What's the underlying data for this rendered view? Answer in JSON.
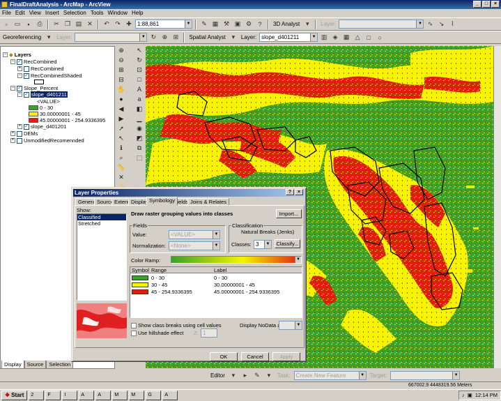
{
  "window": {
    "title": "FinalDraftAnalysis - ArcMap - ArcView"
  },
  "menu": [
    "File",
    "Edit",
    "View",
    "Insert",
    "Selection",
    "Tools",
    "Window",
    "Help"
  ],
  "toolbar1": {
    "scale": "1:88,861",
    "analyst_label": "3D Analyst",
    "layer_label": "Layer:"
  },
  "toolbar2": {
    "georef_label": "Georeferencing",
    "layer_label": "Layer:",
    "spatial_label": "Spatial Analyst",
    "layer2_label": "Layer:",
    "active_layer": "slope_d401211"
  },
  "toc": {
    "root": "Layers",
    "items": {
      "rec_combined": "RecCombined",
      "rec_combined_sub": "RecCombined",
      "rec_combined_shaded": "RecCombinedShaded",
      "slope_percent": "Slope_Percent",
      "slope_sel": "slope_d401211",
      "value_field": "<VALUE>",
      "class1": "0 - 30",
      "class2": "30.00000001 - 45",
      "class3": "45.00000001 - 254.9336395",
      "slope2": "slope_d401201",
      "dems": "DEMs",
      "unmodified": "UnmodifiedRecomennded"
    },
    "tabs": [
      "Display",
      "Source",
      "Selection"
    ]
  },
  "colors": {
    "green": "#3aa12a",
    "yellow": "#f5f500",
    "red": "#e01e10"
  },
  "dialog": {
    "title": "Layer Properties",
    "tabs": [
      "General",
      "Source",
      "Extent",
      "Display",
      "Symbology",
      "Fields",
      "Joins & Relates"
    ],
    "show_label": "Show:",
    "show_items": [
      "Classified",
      "Stretched"
    ],
    "heading": "Draw raster grouping values into classes",
    "import_btn": "Import...",
    "fields_label": "Fields",
    "value_label": "Value:",
    "value_sel": "<VALUE>",
    "norm_label": "Normalization:",
    "norm_sel": "<None>",
    "classification_label": "Classification",
    "method": "Natural Breaks (Jenks)",
    "classes_label": "Classes:",
    "classes_value": "3",
    "classify_btn": "Classify...",
    "color_ramp_label": "Color Ramp:",
    "col_symbol": "Symbol",
    "col_range": "Range",
    "col_label": "Label",
    "rows": [
      {
        "range": "0 - 30",
        "label": "0 - 30",
        "color": "#3aa12a"
      },
      {
        "range": "30 - 45",
        "label": "30.00000001 - 45",
        "color": "#f5f500"
      },
      {
        "range": "45 - 254.9336395",
        "label": "45.00000001 - 254.9336395",
        "color": "#e01e10"
      }
    ],
    "show_breaks": "Show class breaks using cell values",
    "nodata_label": "Display NoData as",
    "hillshade": "Use hillshade effect",
    "z_label": "Z:",
    "z_value": "1",
    "ok": "OK",
    "cancel": "Cancel",
    "apply": "Apply"
  },
  "editor": {
    "editor_label": "Editor",
    "task_label": "Task:",
    "task_value": "Create New Feature",
    "target_label": "Target:"
  },
  "status": {
    "coords": "667002.9  4448319.56 Meters"
  },
  "taskbar": {
    "start": "Start",
    "clock": "12:14 PM",
    "items": [
      "2",
      "F",
      "I",
      "A",
      "A",
      "M",
      "M",
      "G",
      "A"
    ]
  }
}
